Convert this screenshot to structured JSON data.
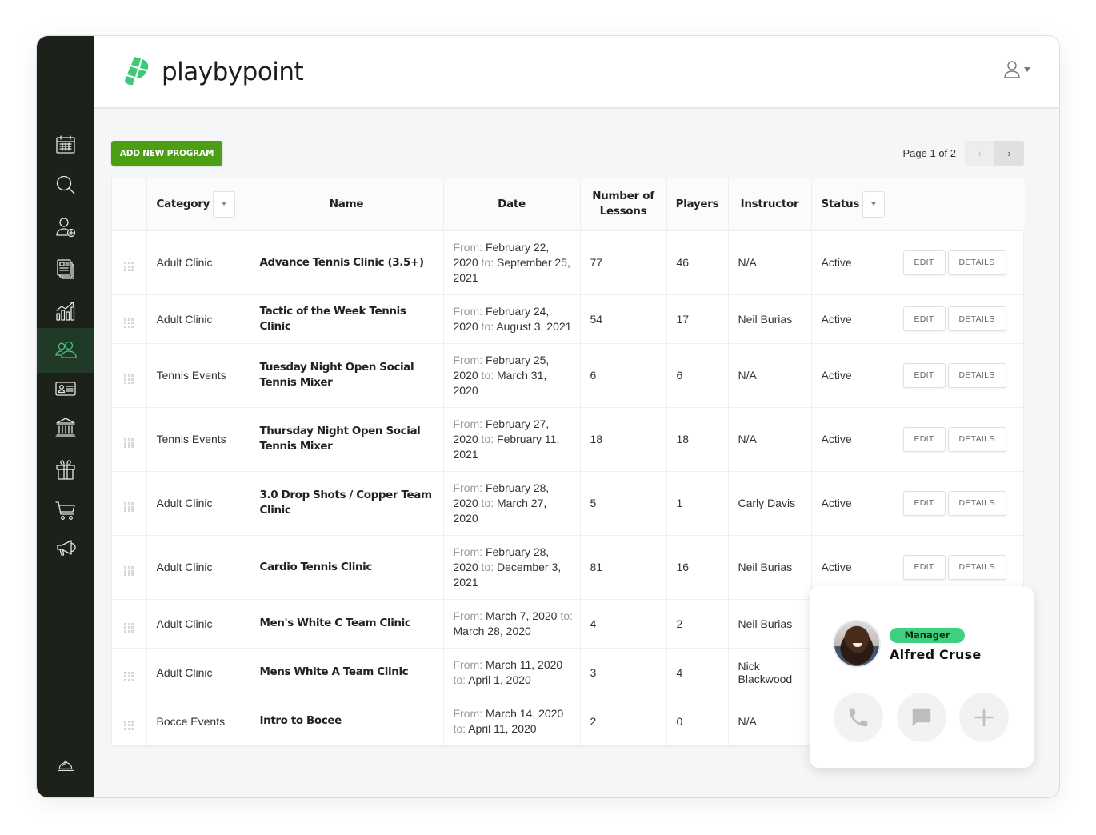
{
  "brand": {
    "name": "playbypoint",
    "accent": "#3ec87a",
    "button_green": "#4c9f13"
  },
  "sidebar": {
    "items": [
      {
        "icon": "calendar-icon",
        "label": "Calendar",
        "active": false
      },
      {
        "icon": "search-icon",
        "label": "Search",
        "active": false
      },
      {
        "icon": "add-user-icon",
        "label": "Add User",
        "active": false
      },
      {
        "icon": "documents-icon",
        "label": "Documents",
        "active": false
      },
      {
        "icon": "analytics-icon",
        "label": "Analytics",
        "active": false
      },
      {
        "icon": "users-icon",
        "label": "Users",
        "active": true
      },
      {
        "icon": "id-card-icon",
        "label": "Memberships",
        "active": false
      },
      {
        "icon": "bank-icon",
        "label": "Facility",
        "active": false
      },
      {
        "icon": "gift-icon",
        "label": "Gifts",
        "active": false
      },
      {
        "icon": "cart-icon",
        "label": "Cart",
        "active": false
      },
      {
        "icon": "megaphone-icon",
        "label": "Marketing",
        "active": false
      }
    ],
    "bottom_icon": "service-bell-icon"
  },
  "toolbar": {
    "add_button": "ADD NEW PROGRAM",
    "pager_text": "Page 1 of 2",
    "prev": "‹",
    "next": "›"
  },
  "table": {
    "columns": [
      "",
      "Category",
      "Name",
      "Date",
      "Number of Lessons",
      "Players",
      "Instructor",
      "Status",
      ""
    ],
    "header": {
      "category": "Category",
      "name": "Name",
      "date": "Date",
      "lessons_line1": "Number of",
      "lessons_line2": "Lessons",
      "players": "Players",
      "instructor": "Instructor",
      "status": "Status"
    },
    "labels": {
      "from": "From:",
      "to": "to:",
      "edit": "EDIT",
      "details": "DETAILS"
    },
    "rows": [
      {
        "category": "Adult Clinic",
        "name": "Advance Tennis Clinic (3.5+)",
        "from": "February 22, 2020",
        "to": "September 25, 2021",
        "lessons": "77",
        "players": "46",
        "instructor": "N/A",
        "status": "Active"
      },
      {
        "category": "Adult Clinic",
        "name": "Tactic of the Week Tennis Clinic",
        "from": "February 24, 2020",
        "to": "August 3, 2021",
        "lessons": "54",
        "players": "17",
        "instructor": "Neil Burias",
        "status": "Active"
      },
      {
        "category": "Tennis Events",
        "name": "Tuesday Night Open Social Tennis Mixer",
        "from": "February 25, 2020",
        "to": "March 31, 2020",
        "lessons": "6",
        "players": "6",
        "instructor": "N/A",
        "status": "Active"
      },
      {
        "category": "Tennis Events",
        "name": "Thursday Night Open Social Tennis Mixer",
        "from": "February 27, 2020",
        "to": "February 11, 2021",
        "lessons": "18",
        "players": "18",
        "instructor": "N/A",
        "status": "Active"
      },
      {
        "category": "Adult Clinic",
        "name": "3.0 Drop Shots / Copper Team Clinic",
        "from": "February 28, 2020",
        "to": "March 27, 2020",
        "lessons": "5",
        "players": "1",
        "instructor": "Carly Davis",
        "status": "Active"
      },
      {
        "category": "Adult Clinic",
        "name": "Cardio Tennis Clinic",
        "from": "February 28, 2020",
        "to": "December 3, 2021",
        "lessons": "81",
        "players": "16",
        "instructor": "Neil Burias",
        "status": "Active"
      },
      {
        "category": "Adult Clinic",
        "name": "Men's White C Team Clinic",
        "from": "March 7, 2020",
        "to": "March 28, 2020",
        "lessons": "4",
        "players": "2",
        "instructor": "Neil Burias",
        "status": ""
      },
      {
        "category": "Adult Clinic",
        "name": "Mens White A Team Clinic",
        "from": "March 11, 2020",
        "to": "April 1, 2020",
        "lessons": "3",
        "players": "4",
        "instructor": "Nick Blackwood",
        "status": ""
      },
      {
        "category": "Bocce Events",
        "name": "Intro to Bocee",
        "from": "March 14, 2020",
        "to": "April 11, 2020",
        "lessons": "2",
        "players": "0",
        "instructor": "N/A",
        "status": ""
      }
    ]
  },
  "contact_card": {
    "role": "Manager",
    "name": "Alfred Cruse",
    "actions": [
      "phone-icon",
      "message-icon",
      "plus-icon"
    ]
  }
}
